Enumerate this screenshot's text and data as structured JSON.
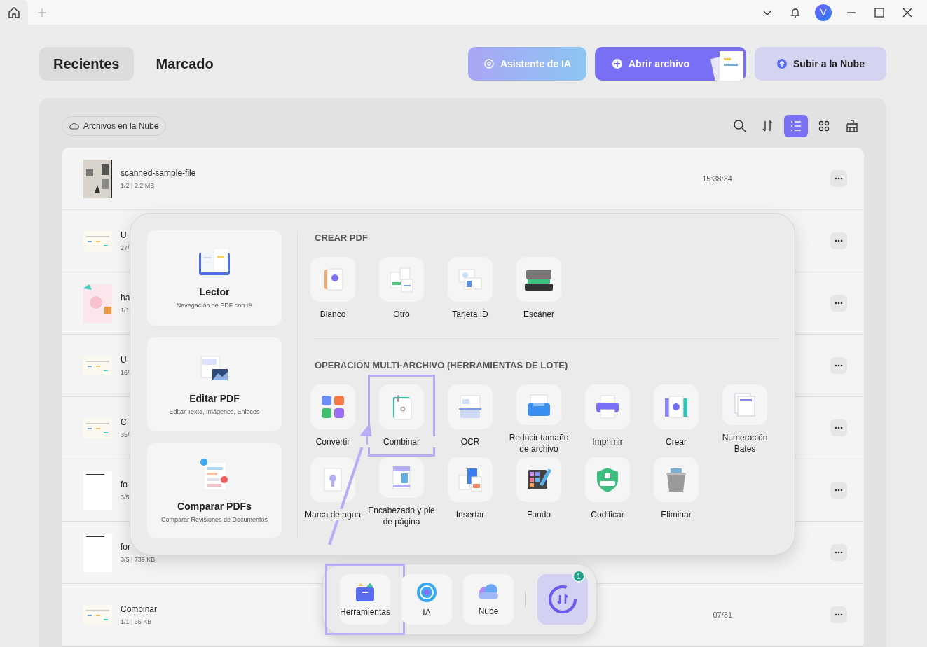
{
  "top_bar": {
    "avatar": "V"
  },
  "nav_tabs": [
    {
      "label": "Recientes",
      "selected": true
    },
    {
      "label": "Marcado",
      "selected": false
    }
  ],
  "actions": [
    {
      "label": "Asistente de IA",
      "kind": "ai"
    },
    {
      "label": "Abrir archivo",
      "kind": "open"
    },
    {
      "label": "Subir a la Nube",
      "kind": "upload"
    }
  ],
  "cloud_filter": "Archivos en la Nube",
  "view_modes": [
    {
      "kind": "list",
      "selected": true
    },
    {
      "kind": "grid",
      "selected": false
    }
  ],
  "files": [
    {
      "name": "scanned-sample-file",
      "meta": "1/2 | 2.2 MB",
      "time": "15:38:34"
    },
    {
      "name": "U",
      "meta": "27/"
    },
    {
      "name": "ha",
      "meta": "1/1"
    },
    {
      "name": "U",
      "meta": "16/"
    },
    {
      "name": "C",
      "meta": "35/"
    },
    {
      "name": "fo",
      "meta": "3/5"
    },
    {
      "name": "for",
      "meta": "3/5 | 739 KB"
    },
    {
      "name": "Combinar",
      "meta": "1/1 | 35 KB",
      "time": "07/31"
    }
  ],
  "tools_panel": {
    "modes": [
      {
        "title": "Lector",
        "subtitle": "Navegación de PDF con IA"
      },
      {
        "title": "Editar PDF",
        "subtitle": "Editar Texto, Imágenes, Enlaces"
      },
      {
        "title": "Comparar PDFs",
        "subtitle": "Comparar Revisiones de Documentos"
      }
    ],
    "sections": [
      {
        "title": "CREAR PDF",
        "items": [
          {
            "label": "Blanco",
            "highlighted": false
          },
          {
            "label": "Otro",
            "highlighted": false
          },
          {
            "label": "Tarjeta ID",
            "highlighted": false
          },
          {
            "label": "Escáner",
            "highlighted": false
          }
        ]
      },
      {
        "title": "OPERACIÓN MULTI-ARCHIVO (HERRAMIENTAS DE LOTE)",
        "items": [
          {
            "label": "Convertir",
            "highlighted": false
          },
          {
            "label": "Combinar",
            "highlighted": true
          },
          {
            "label": "OCR",
            "highlighted": false
          },
          {
            "label": "Reducir tamaño de archivo",
            "highlighted": false
          },
          {
            "label": "Imprimir",
            "highlighted": false
          },
          {
            "label": "Crear",
            "highlighted": false
          },
          {
            "label": "Numeración Bates",
            "highlighted": false
          },
          {
            "label": "Marca de agua",
            "highlighted": false
          },
          {
            "label": "Encabezado y pie de página",
            "highlighted": false
          },
          {
            "label": "Insertar",
            "highlighted": false
          },
          {
            "label": "Fondo",
            "highlighted": false
          },
          {
            "label": "Codificar",
            "highlighted": false
          },
          {
            "label": "Eliminar",
            "highlighted": false
          }
        ]
      }
    ]
  },
  "dock": {
    "items": [
      {
        "label": "Herramientas",
        "highlighted": true
      },
      {
        "label": "IA",
        "highlighted": false
      },
      {
        "label": "Nube",
        "highlighted": false
      }
    ],
    "sync_badge": "1"
  }
}
